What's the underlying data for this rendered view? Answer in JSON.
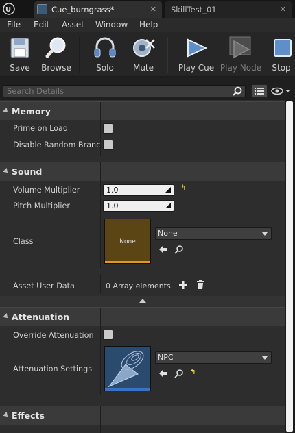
{
  "tabs": [
    {
      "label": "Cue_burngrass*",
      "close": "✕"
    },
    {
      "label": "SkillTest_01",
      "close": "✕"
    }
  ],
  "menu": [
    "File",
    "Edit",
    "Asset",
    "Window",
    "Help"
  ],
  "toolbar": {
    "save": "Save",
    "browse": "Browse",
    "solo": "Solo",
    "mute": "Mute",
    "play_cue": "Play Cue",
    "play_node": "Play Node",
    "stop": "Stop"
  },
  "details": {
    "search_placeholder": "Search Details"
  },
  "categories": {
    "memory": "Memory",
    "sound": "Sound",
    "attenuation": "Attenuation",
    "effects": "Effects"
  },
  "properties": {
    "prime_on_load": "Prime on Load",
    "disable_random_branch": "Disable Random Branch Culling",
    "volume_multiplier": {
      "label": "Volume Multiplier",
      "value": "1.0"
    },
    "pitch_multiplier": {
      "label": "Pitch Multiplier",
      "value": "1.0"
    },
    "class": {
      "label": "Class",
      "thumb_text": "None",
      "value": "None"
    },
    "asset_user_data": {
      "label": "Asset User Data",
      "value": "0 Array elements"
    },
    "override_attenuation": "Override Attenuation",
    "attenuation_settings": {
      "label": "Attenuation Settings",
      "value": "NPC"
    }
  },
  "colors": {
    "accent_reset": "#e8d830",
    "class_thumb_bar": "#e09a20",
    "atten_thumb_bar": "#3a72c8"
  }
}
